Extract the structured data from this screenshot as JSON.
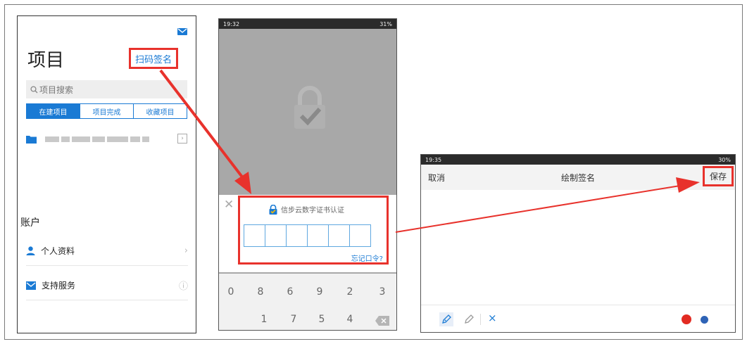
{
  "screen1": {
    "title": "项目",
    "scan_sign_button": "扫码签名",
    "search_placeholder": "项目搜索",
    "tabs": [
      {
        "label": "在建项目",
        "active": true
      },
      {
        "label": "项目完成",
        "active": false
      },
      {
        "label": "收藏项目",
        "active": false
      }
    ],
    "account_heading": "账户",
    "menu": [
      {
        "label": "个人资料",
        "icon": "person-icon",
        "trailing": "›"
      },
      {
        "label": "支持服务",
        "icon": "support-icon",
        "trailing": "ⓘ"
      }
    ]
  },
  "screen2": {
    "status_time": "19:32",
    "status_battery": "31%",
    "auth_title": "信步云数字证书认证",
    "pin_cells": 6,
    "forgot_link": "忘记口令?",
    "keypad": {
      "row1": [
        "0",
        "8",
        "6",
        "9",
        "2",
        "3"
      ],
      "row2": [
        "1",
        "7",
        "5",
        "4"
      ]
    }
  },
  "screen3": {
    "status_time": "19:35",
    "status_battery": "30%",
    "cancel": "取消",
    "title": "绘制签名",
    "save": "保存",
    "clear": "×",
    "colors": [
      "#e22b22",
      "#2e63b6"
    ]
  },
  "colors": {
    "accent": "#1a7ad4",
    "highlight": "#e8322c"
  }
}
